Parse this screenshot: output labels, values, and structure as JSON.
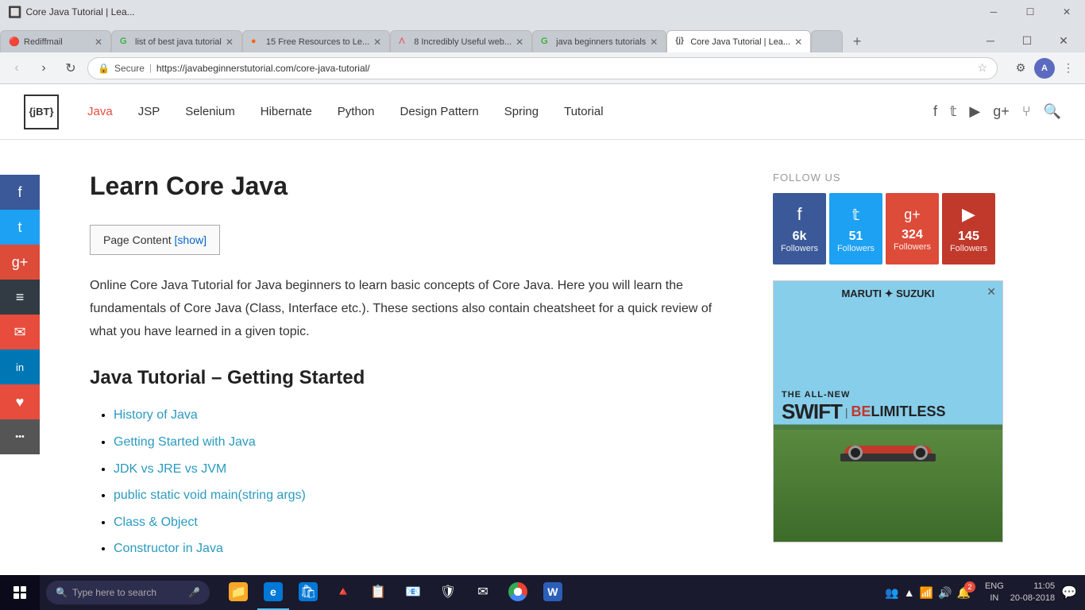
{
  "window": {
    "title": "Core Java Tutorial | Lea...",
    "controls": {
      "minimize": "─",
      "maximize": "☐",
      "close": "✕"
    }
  },
  "tabs": [
    {
      "id": "tab1",
      "favicon": "🔴",
      "title": "Rediffmail",
      "active": false
    },
    {
      "id": "tab2",
      "favicon": "🟢",
      "title": "list of best java tutorial",
      "active": false
    },
    {
      "id": "tab3",
      "favicon": "🔵",
      "title": "15 Free Resources to Le...",
      "active": false
    },
    {
      "id": "tab4",
      "favicon": "🟠",
      "title": "8 Incredibly Useful web...",
      "active": false
    },
    {
      "id": "tab5",
      "favicon": "🟢",
      "title": "java beginners tutorials",
      "active": false
    },
    {
      "id": "tab6",
      "favicon": "⬜",
      "title": "Core Java Tutorial | Lea...",
      "active": true
    },
    {
      "id": "tab7",
      "favicon": "",
      "title": "",
      "active": false
    }
  ],
  "address_bar": {
    "lock_icon": "🔒",
    "secure_text": "Secure",
    "url": "https://javabeginnerstutorial.com/core-java-tutorial/",
    "star_icon": "☆"
  },
  "header": {
    "logo_text": "{jBT}",
    "nav_items": [
      {
        "label": "Java",
        "active": true
      },
      {
        "label": "JSP",
        "active": false
      },
      {
        "label": "Selenium",
        "active": false
      },
      {
        "label": "Hibernate",
        "active": false
      },
      {
        "label": "Python",
        "active": false
      },
      {
        "label": "Design Pattern",
        "active": false
      },
      {
        "label": "Spring",
        "active": false
      },
      {
        "label": "Tutorial",
        "active": false
      }
    ],
    "social_icons": [
      "f",
      "t",
      "▶",
      "g+",
      "gh",
      "🔍"
    ]
  },
  "social_sidebar": {
    "buttons": [
      {
        "id": "fb",
        "icon": "f",
        "class": "fb"
      },
      {
        "id": "tw",
        "icon": "t",
        "class": "tw"
      },
      {
        "id": "gp",
        "icon": "g+",
        "class": "gp"
      },
      {
        "id": "buf",
        "icon": "≡",
        "class": "buf"
      },
      {
        "id": "mail",
        "icon": "✉",
        "class": "mail"
      },
      {
        "id": "li",
        "icon": "in",
        "class": "li"
      },
      {
        "id": "heart",
        "icon": "♥",
        "class": "heart"
      },
      {
        "id": "more",
        "icon": "···",
        "class": "more"
      }
    ]
  },
  "main": {
    "page_title": "Learn Core Java",
    "toc_label": "Page Content",
    "toc_show": "[show]",
    "intro_text": "Online Core Java Tutorial for Java beginners to learn basic concepts of Core Java. Here you will learn the fundamentals of Core Java (Class, Interface etc.). These sections also contain cheatsheet for a quick review of what you have learned in a given topic.",
    "section_title": "Java Tutorial – Getting Started",
    "tutorial_links": [
      {
        "label": "History of Java",
        "href": "#"
      },
      {
        "label": "Getting Started with Java",
        "href": "#"
      },
      {
        "label": "JDK vs JRE vs JVM",
        "href": "#"
      },
      {
        "label": "public static void main(string args)",
        "href": "#"
      },
      {
        "label": "Class & Object",
        "href": "#"
      },
      {
        "label": "Constructor in Java",
        "href": "#"
      }
    ]
  },
  "sidebar": {
    "follow_us_label": "FOLLOW US",
    "social_cards": [
      {
        "id": "fb",
        "icon": "f",
        "count": "6k",
        "label": "Followers",
        "class": "fb"
      },
      {
        "id": "tw",
        "icon": "t",
        "count": "51",
        "label": "Followers",
        "class": "tw"
      },
      {
        "id": "gp",
        "icon": "g+",
        "count": "324",
        "label": "Followers",
        "class": "gp"
      },
      {
        "id": "yt",
        "icon": "▶",
        "count": "145",
        "label": "Followers",
        "class": "yt"
      }
    ],
    "ad": {
      "brand": "MARUTI ✦ SUZUKI",
      "headline_part1": "THE ALL-NEW",
      "product": "SWIFT",
      "tagline_be": "BE",
      "tagline_limitless": "LIMITLESS"
    }
  },
  "taskbar": {
    "search_placeholder": "Type here to search",
    "apps": [
      {
        "id": "file-explorer",
        "icon": "📁",
        "color": "#f9a825"
      },
      {
        "id": "edge",
        "icon": "e",
        "color": "#0078d7"
      },
      {
        "id": "store",
        "icon": "🛍",
        "color": "#0078d7"
      },
      {
        "id": "vlc",
        "icon": "🔺",
        "color": "#f70"
      },
      {
        "id": "office",
        "icon": "📋",
        "color": "#d04"
      },
      {
        "id": "outlook",
        "icon": "📧",
        "color": "#0078d7"
      },
      {
        "id": "malware",
        "icon": "🛡",
        "color": "#c00"
      },
      {
        "id": "mail",
        "icon": "✉",
        "color": "#0078d7"
      },
      {
        "id": "chrome",
        "icon": "●",
        "color": "#4caf50"
      },
      {
        "id": "word",
        "icon": "W",
        "color": "#2b5eb8"
      }
    ],
    "system": {
      "lang": "ENG\nIN",
      "time": "11:05",
      "date": "20-08-2018"
    },
    "notification_count": "2"
  }
}
